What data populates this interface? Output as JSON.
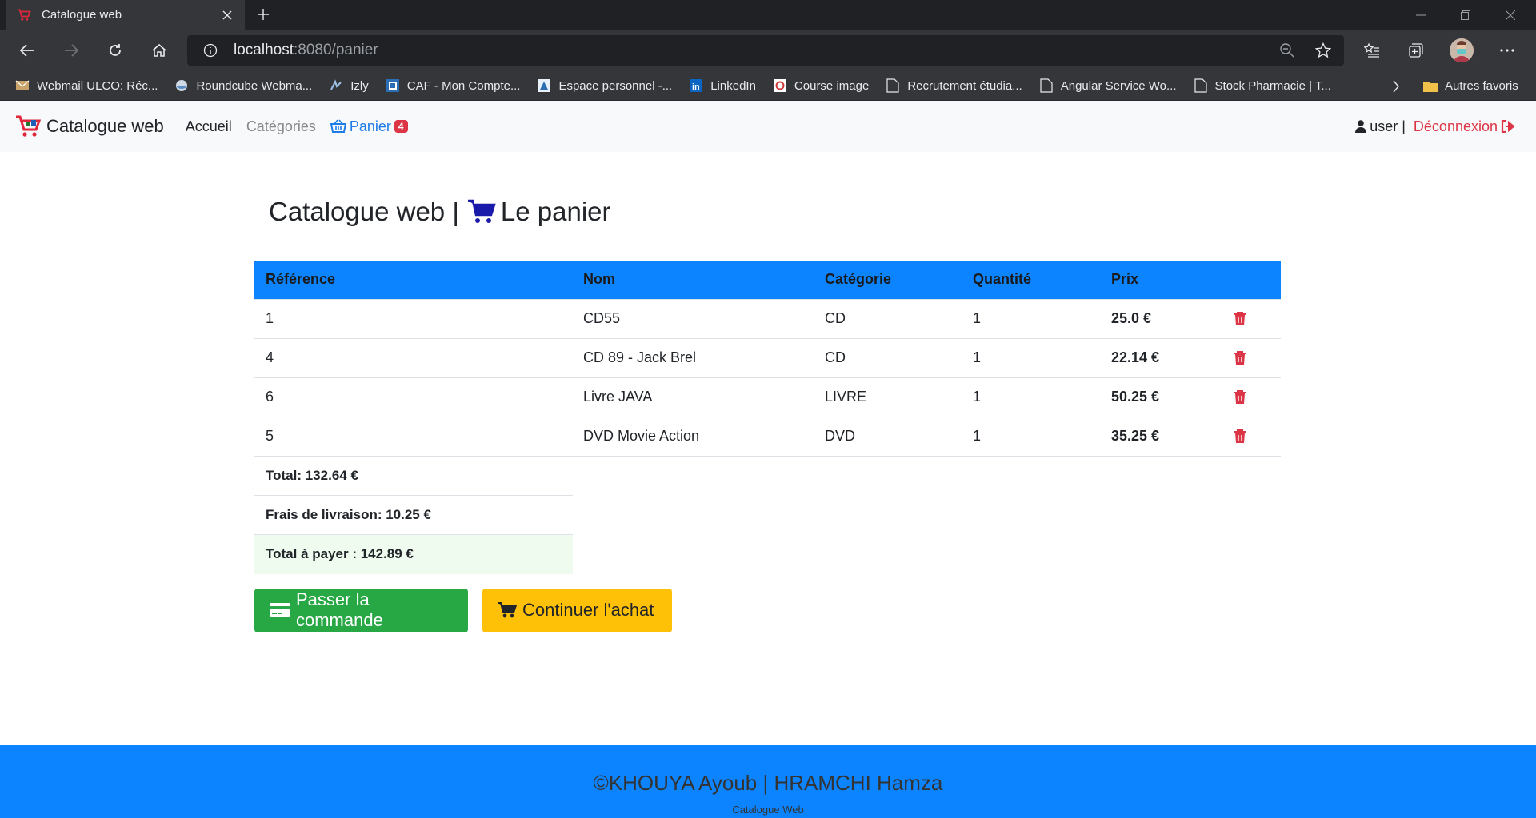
{
  "browser": {
    "tab_title": "Catalogue web",
    "url_host": "localhost",
    "url_rest": ":8080/panier",
    "bookmarks": [
      {
        "label": "Webmail ULCO: Réc...",
        "icon": "webmail-icon"
      },
      {
        "label": "Roundcube Webma...",
        "icon": "roundcube-icon"
      },
      {
        "label": "Izly",
        "icon": "izly-icon"
      },
      {
        "label": "CAF - Mon Compte...",
        "icon": "caf-icon"
      },
      {
        "label": "Espace personnel -...",
        "icon": "espace-icon"
      },
      {
        "label": "LinkedIn",
        "icon": "linkedin-icon"
      },
      {
        "label": "Course image",
        "icon": "course-icon"
      },
      {
        "label": "Recrutement étudia...",
        "icon": "page-icon"
      },
      {
        "label": "Angular Service Wo...",
        "icon": "page-icon"
      },
      {
        "label": "Stock Pharmacie | T...",
        "icon": "page-icon"
      }
    ],
    "other_bookmarks": "Autres favoris"
  },
  "nav": {
    "brand": "Catalogue web",
    "home": "Accueil",
    "categories": "Catégories",
    "cart": "Panier",
    "cart_count": "4",
    "user": "user |",
    "logout": "Déconnexion"
  },
  "page": {
    "title_prefix": "Catalogue web |",
    "title_suffix": "Le panier"
  },
  "table": {
    "headers": [
      "Référence",
      "Nom",
      "Catégorie",
      "Quantité",
      "Prix"
    ],
    "rows": [
      {
        "ref": "1",
        "name": "CD55",
        "category": "CD",
        "qty": "1",
        "price": "25.0 €"
      },
      {
        "ref": "4",
        "name": "CD 89 - Jack Brel",
        "category": "CD",
        "qty": "1",
        "price": "22.14 €"
      },
      {
        "ref": "6",
        "name": "Livre JAVA",
        "category": "LIVRE",
        "qty": "1",
        "price": "50.25 €"
      },
      {
        "ref": "5",
        "name": "DVD Movie Action",
        "category": "DVD",
        "qty": "1",
        "price": "35.25 €"
      }
    ]
  },
  "totals": {
    "total": "Total: 132.64 €",
    "shipping": "Frais de livraison: 10.25 €",
    "grand_total": "Total à payer : 142.89 €"
  },
  "buttons": {
    "order": "Passer la commande",
    "continue": "Continuer l'achat"
  },
  "footer": {
    "credit": "©KHOUYA Ayoub | HRAMCHI Hamza",
    "sub": "Catalogue Web"
  },
  "colors": {
    "primary": "#0d84ff",
    "success": "#28a745",
    "warning": "#ffc107",
    "danger": "#dc3545"
  }
}
